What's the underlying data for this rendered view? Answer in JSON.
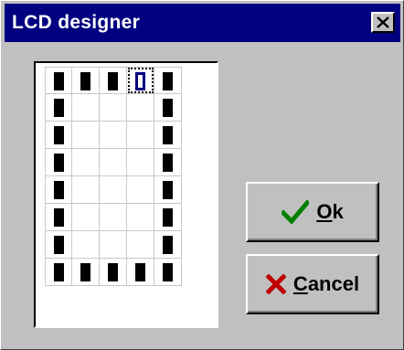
{
  "window": {
    "title": "LCD designer",
    "close_label": "X"
  },
  "grid": {
    "rows": 8,
    "cols": 5,
    "selected": [
      0,
      3
    ],
    "pixels": [
      [
        1,
        1,
        1,
        1,
        1
      ],
      [
        1,
        0,
        0,
        0,
        1
      ],
      [
        1,
        0,
        0,
        0,
        1
      ],
      [
        1,
        0,
        0,
        0,
        1
      ],
      [
        1,
        0,
        0,
        0,
        1
      ],
      [
        1,
        0,
        0,
        0,
        1
      ],
      [
        1,
        0,
        0,
        0,
        1
      ],
      [
        1,
        1,
        1,
        1,
        1
      ]
    ]
  },
  "buttons": {
    "ok": {
      "label_mnemonic": "O",
      "label_rest": "k",
      "icon": "checkmark-icon",
      "icon_color": "#008000"
    },
    "cancel": {
      "label_mnemonic": "C",
      "label_rest": "ancel",
      "icon": "x-icon",
      "icon_color": "#c00000"
    }
  }
}
